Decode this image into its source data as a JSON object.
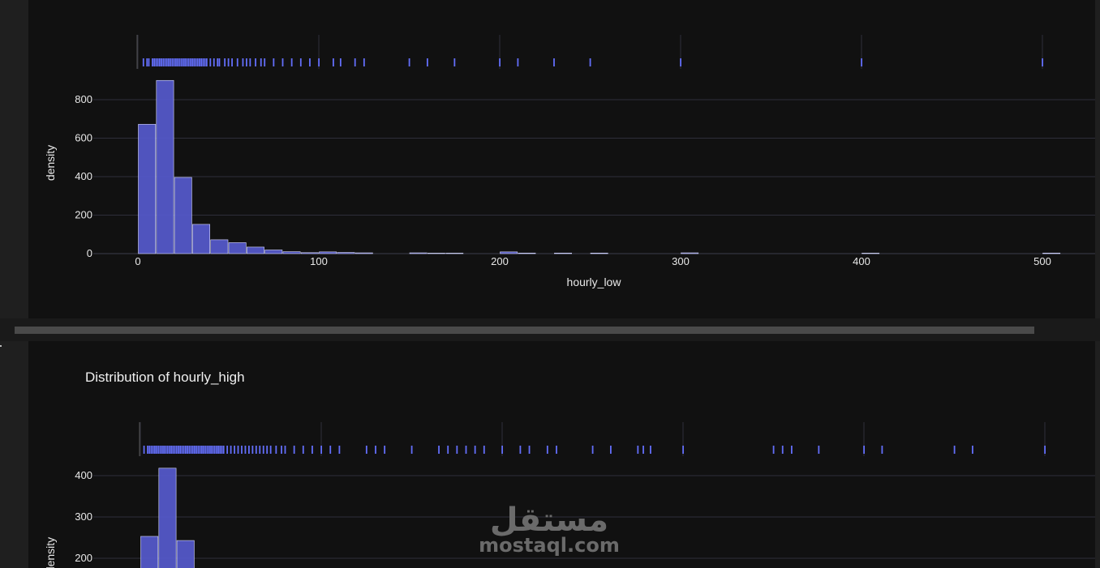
{
  "colors": {
    "page_bg": "#1f1f1f",
    "plot_bg": "#111111",
    "bar_fill": "#5458c8",
    "bar_stroke": "#d8daff",
    "rug": "#636efa",
    "grid": "#2e2e3a",
    "text": "#e8e8e8"
  },
  "watermark": {
    "arabic": "مستقل",
    "latin": "mostaql.com"
  },
  "chart_data": [
    {
      "type": "bar",
      "title": "",
      "xlabel": "hourly_low",
      "ylabel": "density",
      "xlim": [
        -5,
        525
      ],
      "ylim": [
        0,
        900
      ],
      "xticks": [
        0,
        100,
        200,
        300,
        400,
        500
      ],
      "yticks": [
        0,
        200,
        400,
        600,
        800
      ],
      "grid": true,
      "bin_width": 10,
      "bins": [
        {
          "x0": 0,
          "value": 672
        },
        {
          "x0": 10,
          "value": 900
        },
        {
          "x0": 20,
          "value": 396
        },
        {
          "x0": 30,
          "value": 152
        },
        {
          "x0": 40,
          "value": 72
        },
        {
          "x0": 50,
          "value": 57
        },
        {
          "x0": 60,
          "value": 34
        },
        {
          "x0": 70,
          "value": 19
        },
        {
          "x0": 80,
          "value": 10
        },
        {
          "x0": 90,
          "value": 5
        },
        {
          "x0": 100,
          "value": 9
        },
        {
          "x0": 110,
          "value": 6
        },
        {
          "x0": 120,
          "value": 4
        },
        {
          "x0": 150,
          "value": 4
        },
        {
          "x0": 160,
          "value": 2
        },
        {
          "x0": 170,
          "value": 2
        },
        {
          "x0": 200,
          "value": 9
        },
        {
          "x0": 210,
          "value": 3
        },
        {
          "x0": 230,
          "value": 3
        },
        {
          "x0": 250,
          "value": 3
        },
        {
          "x0": 300,
          "value": 4
        },
        {
          "x0": 400,
          "value": 2
        },
        {
          "x0": 500,
          "value": 3
        }
      ],
      "rug": [
        3,
        5,
        6,
        8,
        9,
        10,
        11,
        12,
        13,
        14,
        15,
        16,
        17,
        18,
        19,
        20,
        21,
        22,
        23,
        24,
        25,
        26,
        27,
        28,
        29,
        30,
        31,
        32,
        33,
        34,
        35,
        36,
        37,
        38,
        40,
        42,
        44,
        45,
        48,
        50,
        52,
        55,
        58,
        60,
        62,
        65,
        68,
        70,
        75,
        80,
        85,
        90,
        95,
        100,
        108,
        112,
        120,
        125,
        150,
        160,
        175,
        200,
        210,
        230,
        250,
        300,
        400,
        500
      ]
    },
    {
      "type": "bar",
      "title": "Distribution of hourly_high",
      "xlabel": "",
      "ylabel": "density",
      "xlim": [
        -5,
        525
      ],
      "ylim": [
        150,
        420
      ],
      "xticks": [
        0,
        100,
        200,
        300,
        400,
        500
      ],
      "yticks": [
        200,
        300,
        400
      ],
      "grid": true,
      "bin_width": 10,
      "bins": [
        {
          "x0": 0,
          "value": 253
        },
        {
          "x0": 10,
          "value": 418
        },
        {
          "x0": 20,
          "value": 243
        }
      ],
      "rug": [
        2,
        4,
        5,
        6,
        7,
        8,
        9,
        10,
        11,
        12,
        13,
        14,
        15,
        16,
        17,
        18,
        19,
        20,
        21,
        22,
        23,
        24,
        25,
        26,
        27,
        28,
        29,
        30,
        31,
        32,
        33,
        34,
        35,
        36,
        37,
        38,
        39,
        40,
        41,
        42,
        43,
        44,
        45,
        46,
        48,
        50,
        52,
        54,
        56,
        58,
        60,
        62,
        64,
        66,
        68,
        70,
        72,
        75,
        78,
        80,
        85,
        90,
        95,
        100,
        105,
        110,
        125,
        130,
        135,
        150,
        165,
        170,
        175,
        180,
        185,
        190,
        200,
        210,
        215,
        225,
        230,
        250,
        260,
        275,
        278,
        282,
        300,
        350,
        355,
        360,
        375,
        400,
        410,
        450,
        460,
        500
      ]
    }
  ]
}
